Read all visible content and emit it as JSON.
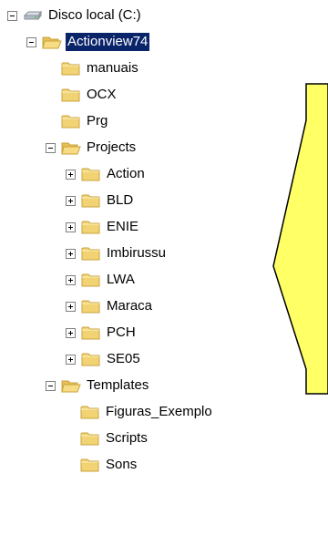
{
  "tree": {
    "root": {
      "label": "Disco local (C:)",
      "icon": "hard-drive-icon"
    },
    "actionview": {
      "label": "Actionview74",
      "icon": "folder-open-icon",
      "selected": true
    },
    "children": [
      {
        "key": "manuais",
        "label": "manuais"
      },
      {
        "key": "ocx",
        "label": "OCX"
      },
      {
        "key": "prg",
        "label": "Prg"
      }
    ],
    "projects": {
      "label": "Projects",
      "items": [
        "Action",
        "BLD",
        "ENIE",
        "Imbirussu",
        "LWA",
        "Maraca",
        "PCH",
        "SE05"
      ]
    },
    "templates": {
      "label": "Templates",
      "items": [
        "Figuras_Exemplo",
        "Scripts",
        "Sons"
      ]
    }
  },
  "colors": {
    "selection": "#0a246a",
    "callout_fill": "#ffff66",
    "folder": "#f2d373",
    "folder_dark": "#c9a33c"
  }
}
